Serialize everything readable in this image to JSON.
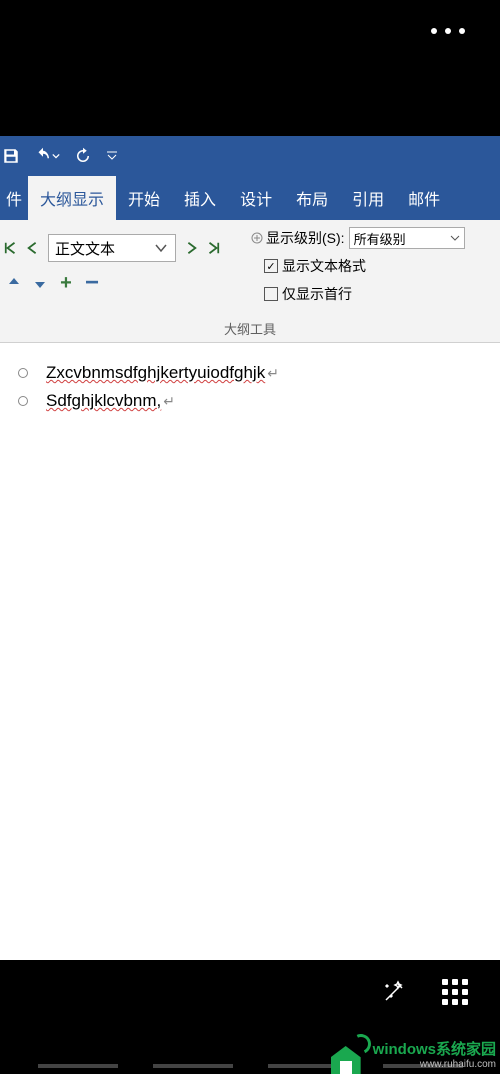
{
  "qat": {
    "items": [
      "save",
      "undo",
      "redo",
      "customize"
    ]
  },
  "tabs": {
    "file": "件",
    "outline": "大纲显示",
    "home": "开始",
    "insert": "插入",
    "design": "设计",
    "layout": "布局",
    "references": "引用",
    "mailings": "邮件"
  },
  "ribbon": {
    "level_select": "正文文本",
    "show_levels_label": "显示级别(S):",
    "show_levels_value": "所有级别",
    "show_formatting": "显示文本格式",
    "show_first_line": "仅显示首行",
    "show_formatting_checked": true,
    "show_first_line_checked": false,
    "group_label": "大纲工具"
  },
  "document": {
    "lines": [
      "Zxcvbnmsdfghjkertyuiodfghjk",
      "Sdfghjklcvbnm,"
    ],
    "para_mark": "↵"
  },
  "watermark": {
    "text": "windows系统家园",
    "url": "www.ruhaifu.com"
  }
}
